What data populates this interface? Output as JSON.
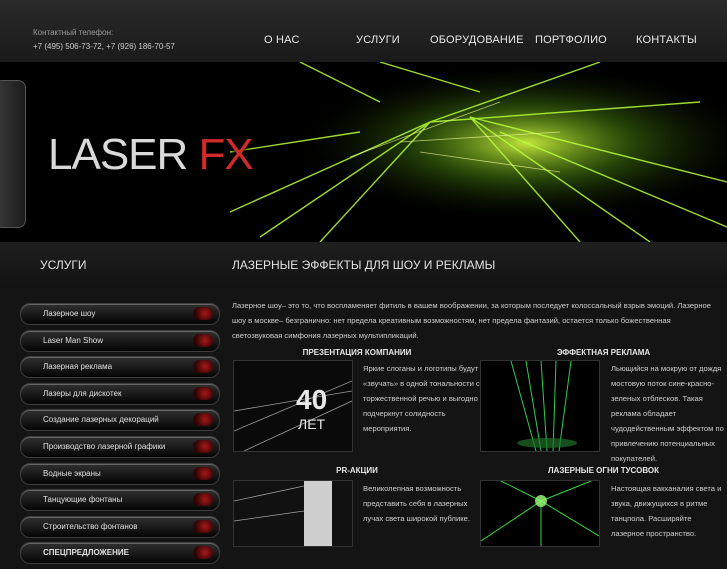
{
  "contact": {
    "label": "Контактный телефон:",
    "numbers": "+7 (495) 506-73-72, +7 (926) 186-70-57"
  },
  "nav": [
    {
      "label": "О НАС"
    },
    {
      "label": "УСЛУГИ"
    },
    {
      "label": "ОБОРУДОВАНИЕ"
    },
    {
      "label": "ПОРТФОЛИО"
    },
    {
      "label": "КОНТАКТЫ"
    }
  ],
  "logo": {
    "part1": "LASER",
    "part2": "FX"
  },
  "sidebar": {
    "title": "УСЛУГИ",
    "items": [
      {
        "label": "Лазерное шоу"
      },
      {
        "label": "Laser Man Show"
      },
      {
        "label": "Лазерная реклама"
      },
      {
        "label": "Лазеры для дискотек"
      },
      {
        "label": "Создание лазерных декораций"
      },
      {
        "label": "Производство лазерной графики"
      },
      {
        "label": "Водные экраны"
      },
      {
        "label": "Танцующие фонтаны"
      },
      {
        "label": "Строительство фонтанов"
      },
      {
        "label": "СПЕЦПРЕДЛОЖЕНИЕ"
      }
    ]
  },
  "main": {
    "title": "ЛАЗЕРНЫЕ ЭФФЕКТЫ ДЛЯ ШОУ И РЕКЛАМЫ",
    "intro": "Лазерное шоу– это то, что воспламеняет фитиль в вашем воображении, за которым последует колоссальный взрыв эмоций. Лазерное шоу в москве– безгранично: нет предела креативным возможностям, нет предела фантазий, остается только божественная светозвуковая симфония лазерных мультипликаций.",
    "blocks": [
      {
        "heading": "ПРЕЗЕНТАЦИЯ КОМПАНИИ",
        "text": "Яркие слоганы и логотипы будут «звучать» в одной тональности с торжественной речью и выгодно подчеркнут солидность мероприятия.",
        "image_text": "40 ЛЕТ"
      },
      {
        "heading": "ЭФФЕКТНАЯ РЕКЛАМА",
        "text": "Льющийся на мокрую от дождя мостовую поток сине-красно-зеленых отблесков. Такая реклама обладает чудодейственным эффектом по привлечению потенциальных покупателей."
      },
      {
        "heading": "PR-АКЦИИ",
        "text": "Великолепная возможность представить себя в лазерных лучах света широкой публике."
      },
      {
        "heading": "ЛАЗЕРНЫЕ ОГНИ ТУСОВОК",
        "text": "Настоящая вакханалия света и звука, движущихся в ритме танцпола. Расширяйте лазерное пространство."
      }
    ]
  }
}
